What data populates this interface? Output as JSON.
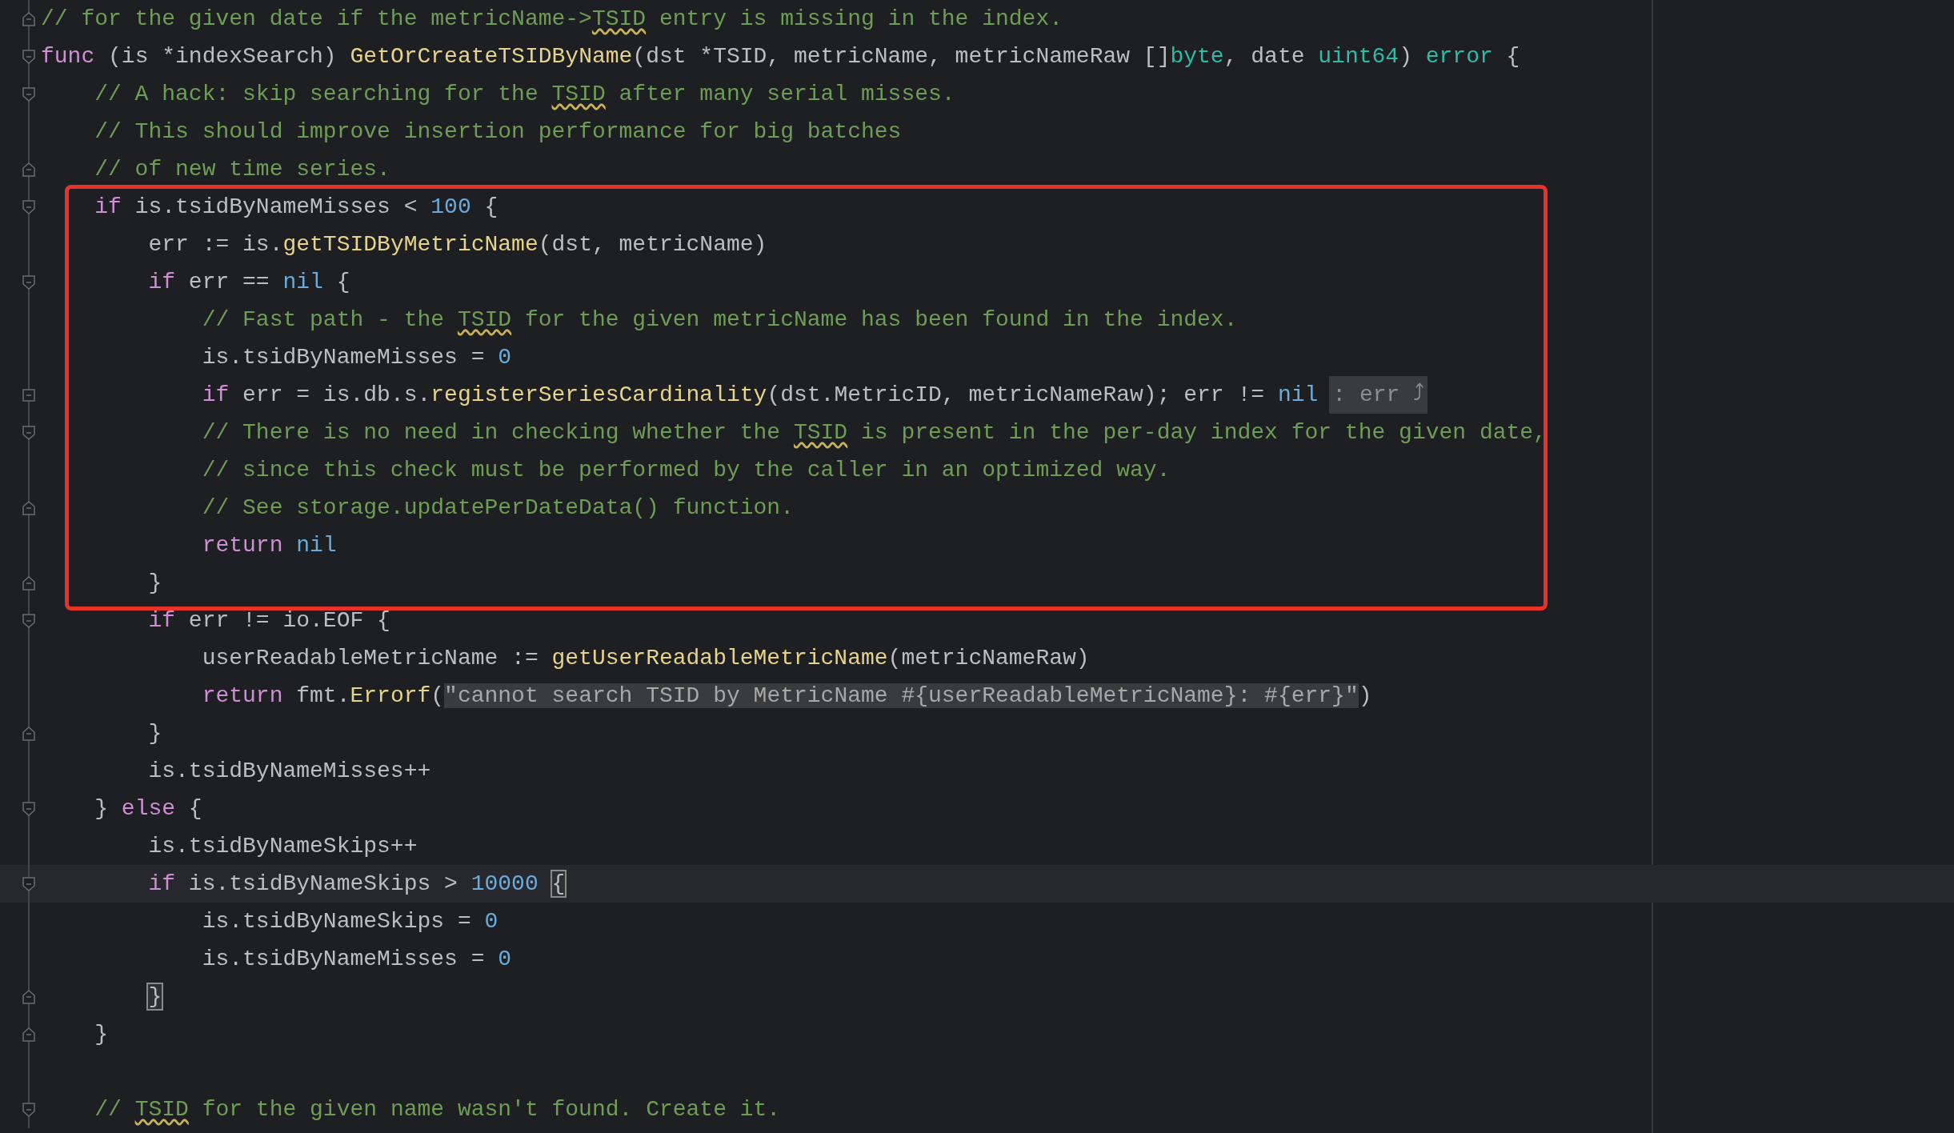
{
  "editor": {
    "segments": [
      {
        "boxed": false,
        "lines": [
          {
            "kind": "end",
            "current": false,
            "tokens": [
              {
                "kind": "comment",
                "text": "// for the given date if the metricName->"
              },
              {
                "kind": "typo",
                "text": "TSID"
              },
              {
                "kind": "comment",
                "text": " entry is missing in the index."
              }
            ]
          },
          {
            "kind": "start",
            "current": false,
            "tokens": [
              {
                "kind": "kw",
                "text": "func"
              },
              {
                "kind": "plain",
                "text": " (is *indexSearch) "
              },
              {
                "kind": "fn",
                "text": "GetOrCreateTSIDByName"
              },
              {
                "kind": "plain",
                "text": "(dst *TSID, metricName, metricNameRaw []"
              },
              {
                "kind": "type",
                "text": "byte"
              },
              {
                "kind": "plain",
                "text": ", date "
              },
              {
                "kind": "type",
                "text": "uint64"
              },
              {
                "kind": "plain",
                "text": ") "
              },
              {
                "kind": "type",
                "text": "error"
              },
              {
                "kind": "plain",
                "text": " {"
              }
            ]
          },
          {
            "kind": "start",
            "current": false,
            "tokens": [
              {
                "kind": "comment",
                "text": "    // A hack: skip searching for the "
              },
              {
                "kind": "typo",
                "text": "TSID"
              },
              {
                "kind": "comment",
                "text": " after many serial misses."
              }
            ]
          },
          {
            "kind": "plain",
            "current": false,
            "tokens": [
              {
                "kind": "comment",
                "text": "    // This should improve insertion performance for big batches"
              }
            ]
          },
          {
            "kind": "end",
            "current": false,
            "tokens": [
              {
                "kind": "comment",
                "text": "    // of new time series."
              }
            ]
          }
        ]
      },
      {
        "boxed": true,
        "lines": [
          {
            "kind": "start",
            "current": false,
            "tokens": [
              {
                "kind": "kw",
                "text": "    if"
              },
              {
                "kind": "plain",
                "text": " is.tsidByNameMisses < "
              },
              {
                "kind": "num",
                "text": "100"
              },
              {
                "kind": "plain",
                "text": " {"
              }
            ]
          },
          {
            "kind": "plain",
            "current": false,
            "tokens": [
              {
                "kind": "plain",
                "text": "        err := is."
              },
              {
                "kind": "fn",
                "text": "getTSIDByMetricName"
              },
              {
                "kind": "plain",
                "text": "(dst, metricName)"
              }
            ]
          },
          {
            "kind": "start",
            "current": false,
            "tokens": [
              {
                "kind": "kw",
                "text": "        if"
              },
              {
                "kind": "plain",
                "text": " err == "
              },
              {
                "kind": "num",
                "text": "nil"
              },
              {
                "kind": "plain",
                "text": " {"
              }
            ]
          },
          {
            "kind": "plain",
            "current": false,
            "tokens": [
              {
                "kind": "comment",
                "text": "            // Fast path - the "
              },
              {
                "kind": "typo",
                "text": "TSID"
              },
              {
                "kind": "comment",
                "text": " for the given metricName has been found in the index."
              }
            ]
          },
          {
            "kind": "plain",
            "current": false,
            "tokens": [
              {
                "kind": "plain",
                "text": "            is.tsidByNameMisses = "
              },
              {
                "kind": "num",
                "text": "0"
              }
            ]
          },
          {
            "kind": "collapsed",
            "current": false,
            "tokens": [
              {
                "kind": "kw",
                "text": "            if"
              },
              {
                "kind": "plain",
                "text": " err = is.db.s."
              },
              {
                "kind": "fn",
                "text": "registerSeriesCardinality"
              },
              {
                "kind": "plain",
                "text": "(dst.MetricID, metricNameRaw); err != "
              },
              {
                "kind": "num",
                "text": "nil"
              }
            ],
            "hint": ": err ⤴"
          },
          {
            "kind": "start",
            "current": false,
            "tokens": [
              {
                "kind": "comment",
                "text": "            // There is no need in checking whether the "
              },
              {
                "kind": "typo",
                "text": "TSID"
              },
              {
                "kind": "comment",
                "text": " is present in the per-day index for the given date,"
              }
            ]
          },
          {
            "kind": "plain",
            "current": false,
            "tokens": [
              {
                "kind": "comment",
                "text": "            // since this check must be performed by the caller in an optimized way."
              }
            ]
          },
          {
            "kind": "end",
            "current": false,
            "tokens": [
              {
                "kind": "comment",
                "text": "            // See storage.updatePerDateData() function."
              }
            ]
          },
          {
            "kind": "plain",
            "current": false,
            "tokens": [
              {
                "kind": "kw",
                "text": "            return "
              },
              {
                "kind": "num",
                "text": "nil"
              }
            ]
          },
          {
            "kind": "end",
            "current": false,
            "tokens": [
              {
                "kind": "plain",
                "text": "        }"
              }
            ]
          }
        ]
      },
      {
        "boxed": false,
        "lines": [
          {
            "kind": "start",
            "current": false,
            "tokens": [
              {
                "kind": "kw",
                "text": "        if"
              },
              {
                "kind": "plain",
                "text": " err != io.EOF {"
              }
            ]
          },
          {
            "kind": "plain",
            "current": false,
            "tokens": [
              {
                "kind": "plain",
                "text": "            userReadableMetricName := "
              },
              {
                "kind": "fn",
                "text": "getUserReadableMetricName"
              },
              {
                "kind": "plain",
                "text": "(metricNameRaw)"
              }
            ]
          },
          {
            "kind": "plain",
            "current": false,
            "tokens": [
              {
                "kind": "kw",
                "text": "            return"
              },
              {
                "kind": "plain",
                "text": " fmt."
              },
              {
                "kind": "fn",
                "text": "Errorf"
              },
              {
                "kind": "plain",
                "text": "("
              },
              {
                "kind": "string",
                "text": "\"cannot search TSID by MetricName #{userReadableMetricName}: #{err}\""
              },
              {
                "kind": "plain",
                "text": ")"
              }
            ]
          },
          {
            "kind": "end",
            "current": false,
            "tokens": [
              {
                "kind": "plain",
                "text": "        }"
              }
            ]
          },
          {
            "kind": "plain",
            "current": false,
            "tokens": [
              {
                "kind": "plain",
                "text": "        is.tsidByNameMisses++"
              }
            ]
          },
          {
            "kind": "start",
            "current": false,
            "tokens": [
              {
                "kind": "plain",
                "text": "    } "
              },
              {
                "kind": "kw",
                "text": "else"
              },
              {
                "kind": "plain",
                "text": " {"
              }
            ]
          },
          {
            "kind": "plain",
            "current": false,
            "tokens": [
              {
                "kind": "plain",
                "text": "        is.tsidByNameSkips++"
              }
            ]
          },
          {
            "kind": "start",
            "current": true,
            "tokens": [
              {
                "kind": "kw",
                "text": "        if"
              },
              {
                "kind": "plain",
                "text": " is.tsidByNameSkips > "
              },
              {
                "kind": "num",
                "text": "10000 "
              },
              {
                "kind": "brace",
                "text": "{"
              }
            ]
          },
          {
            "kind": "plain",
            "current": false,
            "tokens": [
              {
                "kind": "plain",
                "text": "            is.tsidByNameSkips = "
              },
              {
                "kind": "num",
                "text": "0"
              }
            ]
          },
          {
            "kind": "plain",
            "current": false,
            "tokens": [
              {
                "kind": "plain",
                "text": "            is.tsidByNameMisses = "
              },
              {
                "kind": "num",
                "text": "0"
              }
            ]
          },
          {
            "kind": "end",
            "current": false,
            "tokens": [
              {
                "kind": "brace",
                "text": "        }"
              }
            ]
          },
          {
            "kind": "end",
            "current": false,
            "tokens": [
              {
                "kind": "plain",
                "text": "    }"
              }
            ]
          },
          {
            "kind": "plain",
            "current": false
          },
          {
            "kind": "start",
            "current": false,
            "tokens": [
              {
                "kind": "comment",
                "text": "    // "
              },
              {
                "kind": "typo",
                "text": "TSID"
              },
              {
                "kind": "comment",
                "text": " for the given name wasn't found. Create it."
              }
            ]
          }
        ]
      }
    ]
  }
}
